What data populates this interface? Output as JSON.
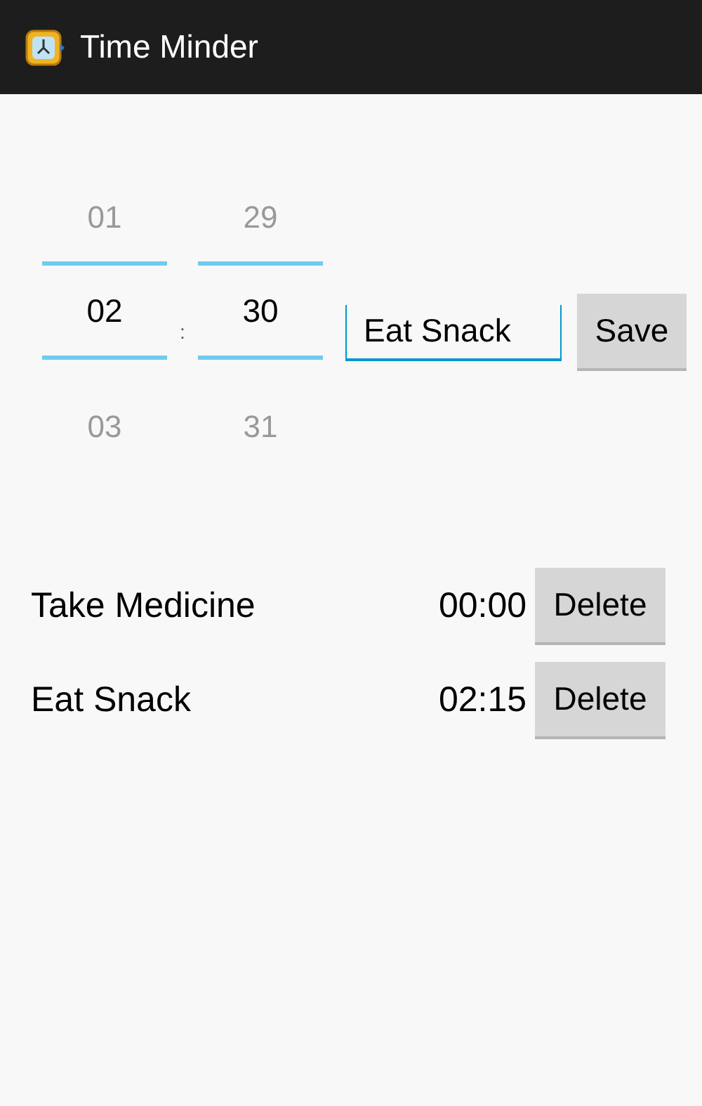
{
  "action_bar": {
    "title": "Time Minder"
  },
  "time_picker": {
    "columns": [
      {
        "previous": "01",
        "value": "02",
        "next": "03"
      },
      {
        "previous": "29",
        "value": "30",
        "next": "31"
      }
    ],
    "separator": ":"
  },
  "name_field": {
    "value": "Eat Snack"
  },
  "save_button": "Save",
  "reminders": [
    {
      "name": "Take Medicine",
      "time": "00:00",
      "button": "Delete"
    },
    {
      "name": "Eat Snack",
      "time": "02:15",
      "button": "Delete"
    }
  ]
}
